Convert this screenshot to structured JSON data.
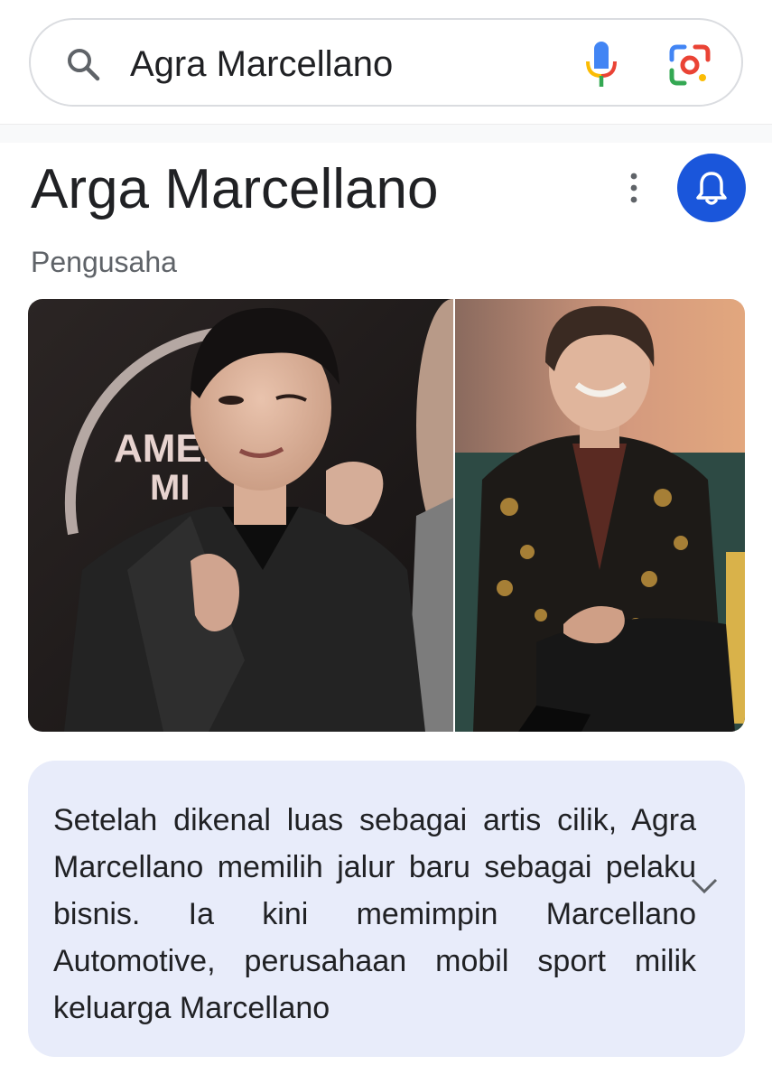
{
  "search": {
    "query": "Agra Marcellano",
    "icons": [
      "search-icon",
      "mic-icon",
      "lens-icon"
    ]
  },
  "entity": {
    "title": "Arga Marcellano",
    "subtitle": "Pengusaha",
    "icons": [
      "more-vert-icon",
      "bell-icon"
    ]
  },
  "photos": {
    "left_sign_text": "AMER\nMI"
  },
  "description": {
    "text": "Setelah dikenal luas sebagai artis cilik, Agra Marcellano memilih jalur baru sebagai pelaku bisnis. Ia kini memimpin Marcellano Automotive, perusahaan mobil sport milik keluarga Marcellano",
    "icon": "chevron-down-icon"
  },
  "colors": {
    "accent_blue": "#1a56db",
    "card_bg": "#e8ecfa",
    "text": "#202124",
    "subtext": "#5f6368"
  }
}
